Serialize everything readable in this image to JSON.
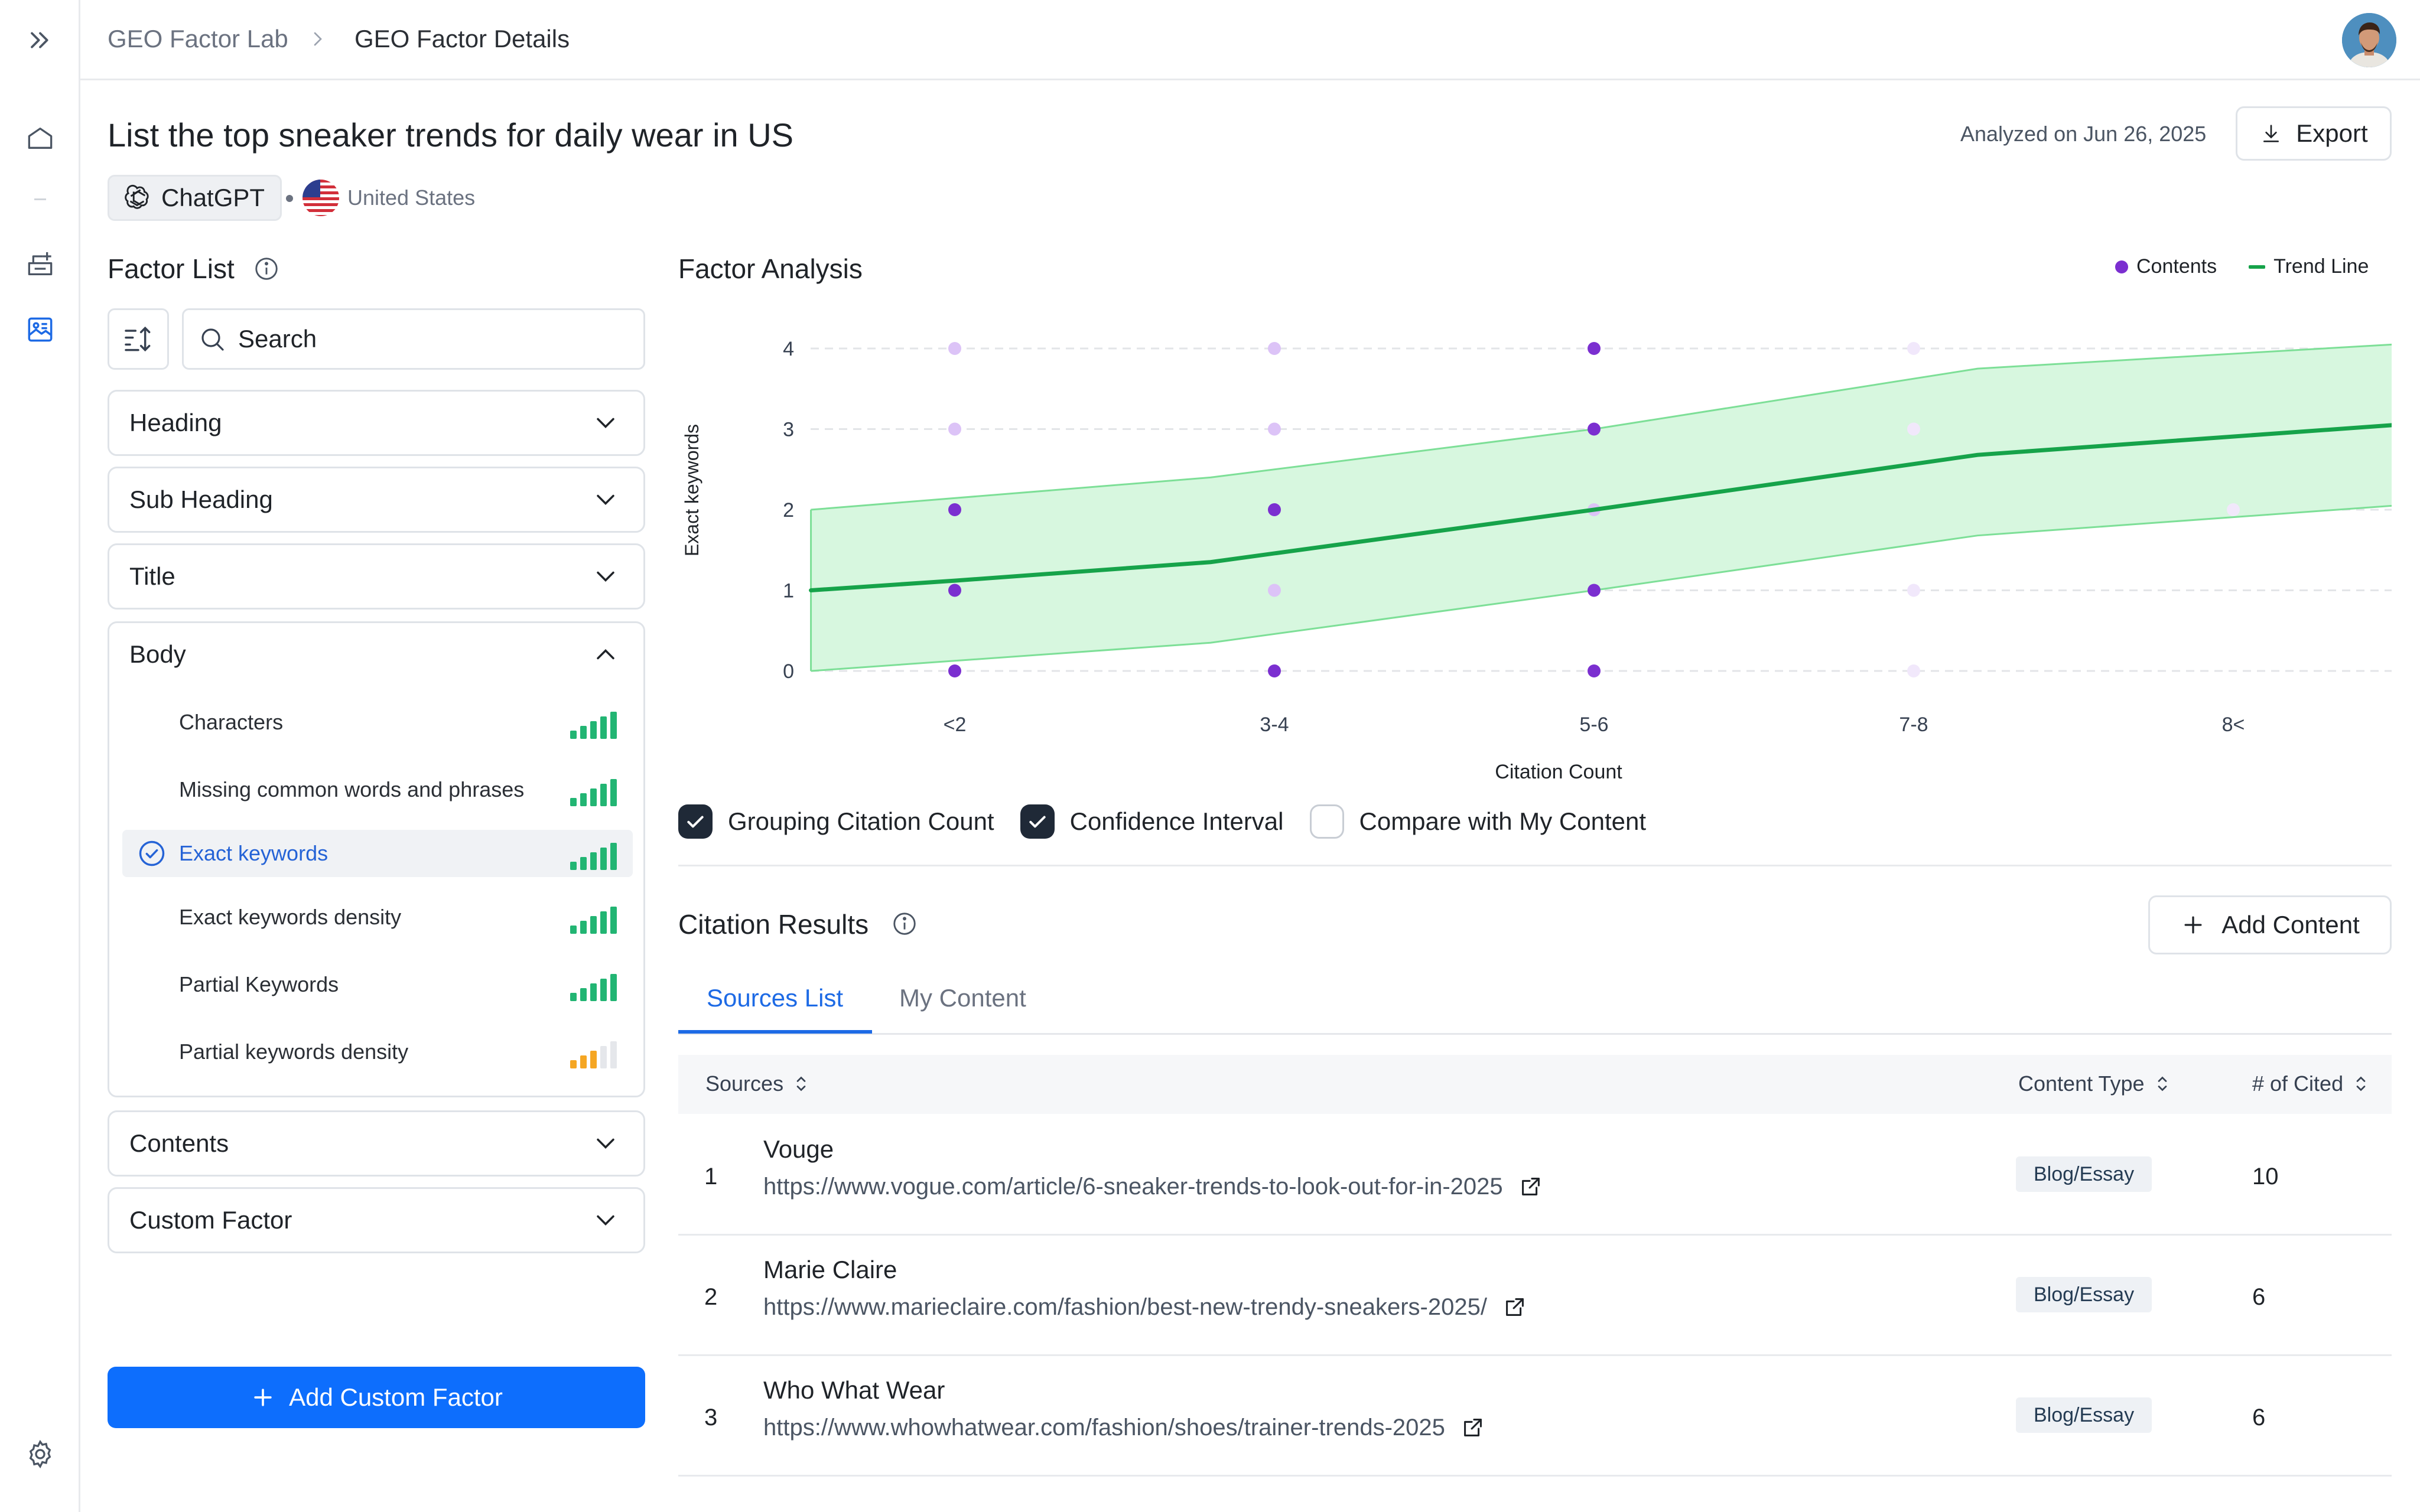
{
  "breadcrumb": {
    "parent": "GEO Factor Lab",
    "current": "GEO Factor Details"
  },
  "header": {
    "title": "List the top sneaker trends for daily wear in US",
    "model": "ChatGPT",
    "country": "United States",
    "analyzed": "Analyzed on Jun 26, 2025",
    "export_label": "Export"
  },
  "factor_list": {
    "title": "Factor List",
    "search_placeholder": "Search",
    "groups": [
      {
        "label": "Heading",
        "expanded": false
      },
      {
        "label": "Sub Heading",
        "expanded": false
      },
      {
        "label": "Title",
        "expanded": false
      },
      {
        "label": "Body",
        "expanded": true
      },
      {
        "label": "Contents",
        "expanded": false
      },
      {
        "label": "Custom Factor",
        "expanded": false
      }
    ],
    "body_items": [
      {
        "label": "Characters",
        "strength": 5,
        "color": "#22b573",
        "selected": false
      },
      {
        "label": "Missing common words and phrases",
        "strength": 5,
        "color": "#22b573",
        "selected": false
      },
      {
        "label": "Exact keywords",
        "strength": 5,
        "color": "#22b573",
        "selected": true
      },
      {
        "label": "Exact keywords density",
        "strength": 5,
        "color": "#22b573",
        "selected": false
      },
      {
        "label": "Partial Keywords",
        "strength": 5,
        "color": "#22b573",
        "selected": false
      },
      {
        "label": "Partial keywords density",
        "strength": 3,
        "color": "#f5a623",
        "selected": false
      }
    ],
    "add_label": "Add Custom Factor"
  },
  "factor_analysis": {
    "title": "Factor Analysis",
    "legend_contents": "Contents",
    "legend_trend": "Trend Line",
    "checkboxes": [
      {
        "label": "Grouping Citation Count",
        "checked": true
      },
      {
        "label": "Confidence Interval",
        "checked": true
      },
      {
        "label": "Compare with My Content",
        "checked": false
      }
    ]
  },
  "chart_data": {
    "type": "scatter",
    "xlabel": "Citation Count",
    "ylabel": "Exact keywords",
    "categories": [
      "<2",
      "3-4",
      "5-6",
      "7-8",
      "8<"
    ],
    "yticks": [
      0,
      1,
      2,
      3,
      4
    ],
    "ylim": [
      0,
      4
    ],
    "points": [
      {
        "x": "<2",
        "y": 4,
        "strong": false
      },
      {
        "x": "<2",
        "y": 3,
        "strong": false
      },
      {
        "x": "<2",
        "y": 2,
        "strong": true
      },
      {
        "x": "<2",
        "y": 1,
        "strong": true
      },
      {
        "x": "<2",
        "y": 0,
        "strong": true
      },
      {
        "x": "3-4",
        "y": 4,
        "strong": false
      },
      {
        "x": "3-4",
        "y": 3,
        "strong": false
      },
      {
        "x": "3-4",
        "y": 2,
        "strong": true
      },
      {
        "x": "3-4",
        "y": 1,
        "strong": false
      },
      {
        "x": "3-4",
        "y": 0,
        "strong": true
      },
      {
        "x": "5-6",
        "y": 4,
        "strong": true
      },
      {
        "x": "5-6",
        "y": 3,
        "strong": true
      },
      {
        "x": "5-6",
        "y": 2,
        "strong": false
      },
      {
        "x": "5-6",
        "y": 1,
        "strong": true
      },
      {
        "x": "5-6",
        "y": 0,
        "strong": true
      },
      {
        "x": "7-8",
        "y": 4,
        "strong": false
      },
      {
        "x": "7-8",
        "y": 3,
        "strong": false
      },
      {
        "x": "7-8",
        "y": 1,
        "strong": false
      },
      {
        "x": "7-8",
        "y": 0,
        "strong": false
      },
      {
        "x": "8<",
        "y": 2,
        "strong": false
      }
    ],
    "trend": [
      {
        "x": -0.45,
        "y": 1.0
      },
      {
        "x": 0.0,
        "y": 1.12
      },
      {
        "x": 0.8,
        "y": 1.35
      },
      {
        "x": 2.0,
        "y": 2.0
      },
      {
        "x": 3.2,
        "y": 2.68
      },
      {
        "x": 4.5,
        "y": 3.05
      }
    ],
    "ci_upper": [
      {
        "x": -0.45,
        "y": 2.0
      },
      {
        "x": 0.8,
        "y": 2.4
      },
      {
        "x": 2.0,
        "y": 3.0
      },
      {
        "x": 3.2,
        "y": 3.75
      },
      {
        "x": 4.5,
        "y": 4.05
      }
    ],
    "ci_lower": [
      {
        "x": -0.45,
        "y": 0.0
      },
      {
        "x": 0.8,
        "y": 0.35
      },
      {
        "x": 2.0,
        "y": 1.0
      },
      {
        "x": 3.2,
        "y": 1.68
      },
      {
        "x": 4.5,
        "y": 2.05
      }
    ]
  },
  "citation_results": {
    "title": "Citation Results",
    "add_label": "Add Content",
    "tabs": [
      "Sources List",
      "My Content"
    ],
    "columns": {
      "sources": "Sources",
      "content_type": "Content Type",
      "cited": "# of Cited"
    },
    "rows": [
      {
        "num": "1",
        "name": "Vouge",
        "url": "https://www.vogue.com/article/6-sneaker-trends-to-look-out-for-in-2025",
        "type": "Blog/Essay",
        "cited": "10"
      },
      {
        "num": "2",
        "name": "Marie Claire",
        "url": "https://www.marieclaire.com/fashion/best-new-trendy-sneakers-2025/",
        "type": "Blog/Essay",
        "cited": "6"
      },
      {
        "num": "3",
        "name": "Who What Wear",
        "url": "https://www.whowhatwear.com/fashion/shoes/trainer-trends-2025",
        "type": "Blog/Essay",
        "cited": "6"
      }
    ]
  }
}
